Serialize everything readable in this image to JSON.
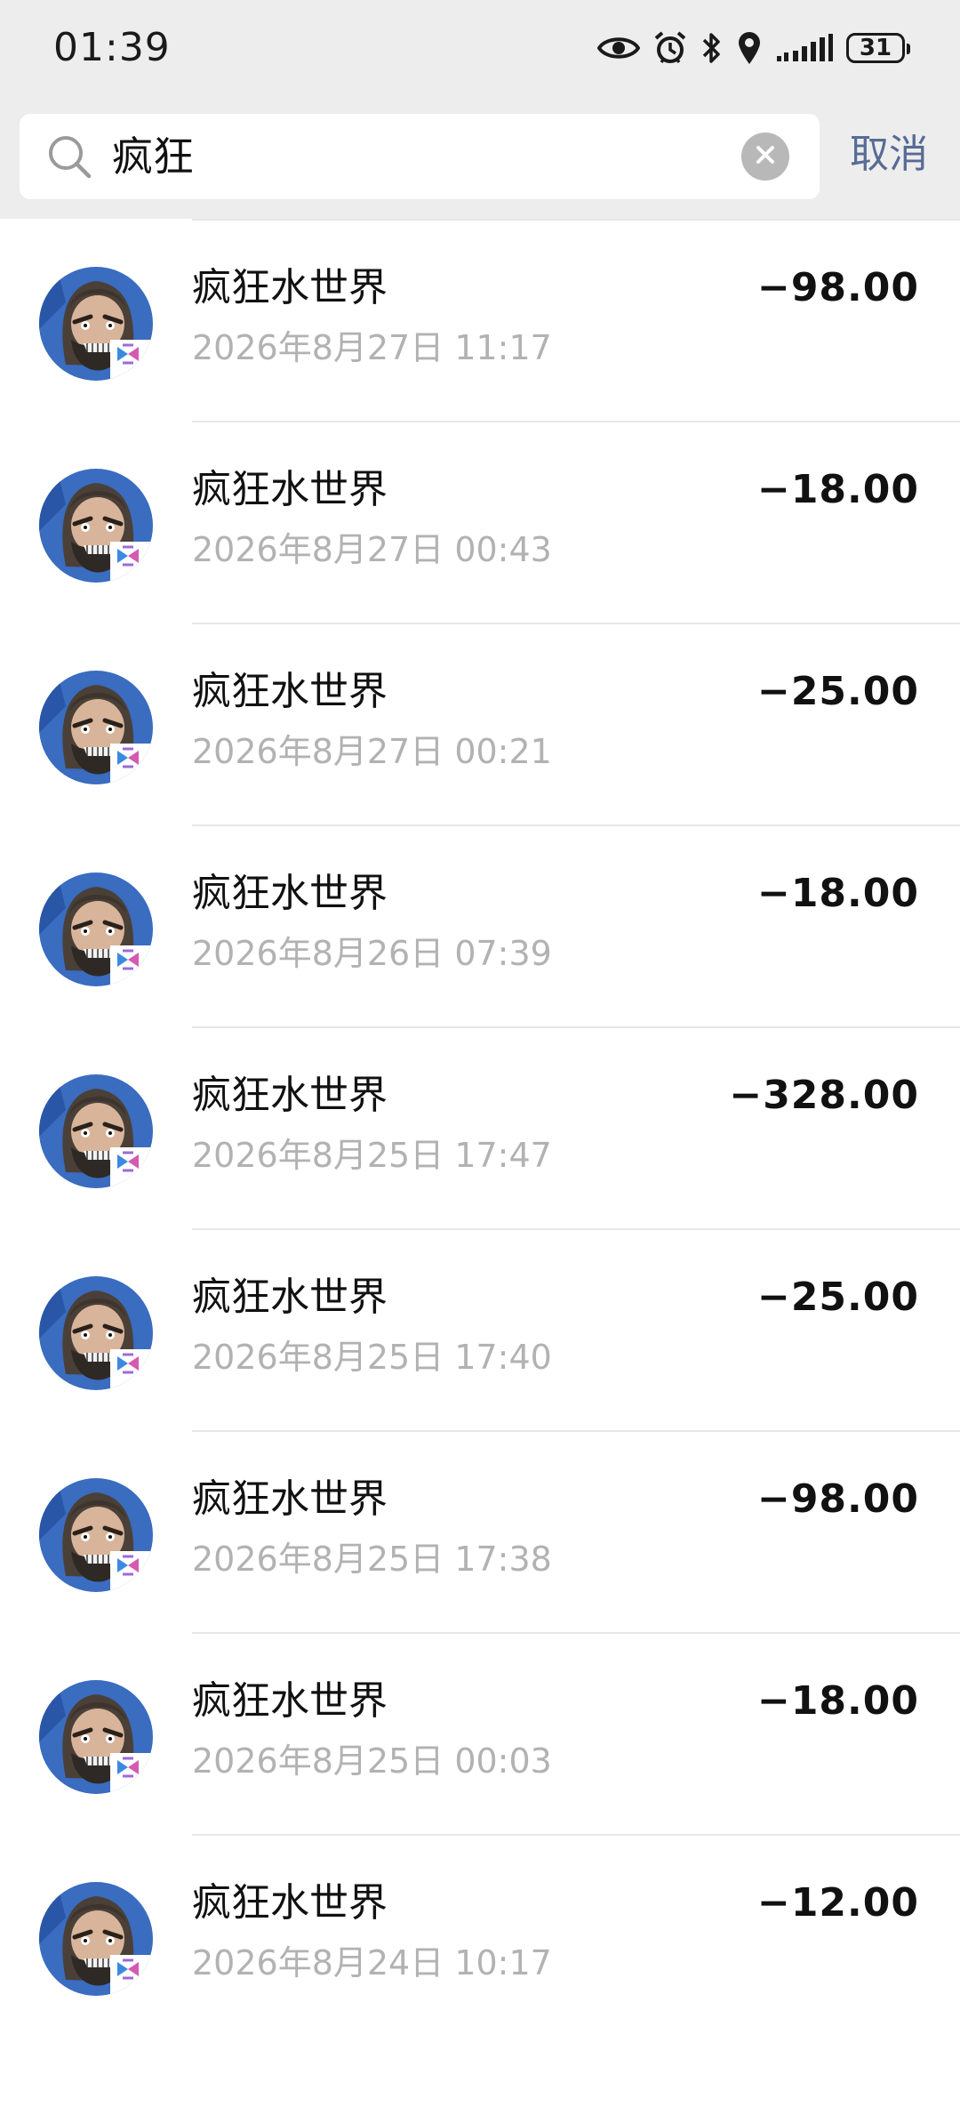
{
  "status_bar": {
    "time": "01:39",
    "battery": "31",
    "icons": [
      "eye-icon",
      "alarm-icon",
      "bluetooth-icon",
      "location-icon",
      "signal-icon",
      "battery-icon"
    ]
  },
  "search": {
    "query": "疯狂",
    "cancel_label": "取消"
  },
  "transactions": [
    {
      "name": "疯狂水世界",
      "time": "2026年8月27日 11:17",
      "amount": "−98.00"
    },
    {
      "name": "疯狂水世界",
      "time": "2026年8月27日 00:43",
      "amount": "−18.00"
    },
    {
      "name": "疯狂水世界",
      "time": "2026年8月27日 00:21",
      "amount": "−25.00"
    },
    {
      "name": "疯狂水世界",
      "time": "2026年8月26日 07:39",
      "amount": "−18.00"
    },
    {
      "name": "疯狂水世界",
      "time": "2026年8月25日 17:47",
      "amount": "−328.00"
    },
    {
      "name": "疯狂水世界",
      "time": "2026年8月25日 17:40",
      "amount": "−25.00"
    },
    {
      "name": "疯狂水世界",
      "time": "2026年8月25日 17:38",
      "amount": "−98.00"
    },
    {
      "name": "疯狂水世界",
      "time": "2026年8月25日 00:03",
      "amount": "−18.00"
    },
    {
      "name": "疯狂水世界",
      "time": "2026年8月24日 10:17",
      "amount": "−12.00"
    }
  ],
  "colors": {
    "header_bg": "#ededed",
    "accent": "#576b95",
    "secondary_text": "#b2b2b2"
  }
}
